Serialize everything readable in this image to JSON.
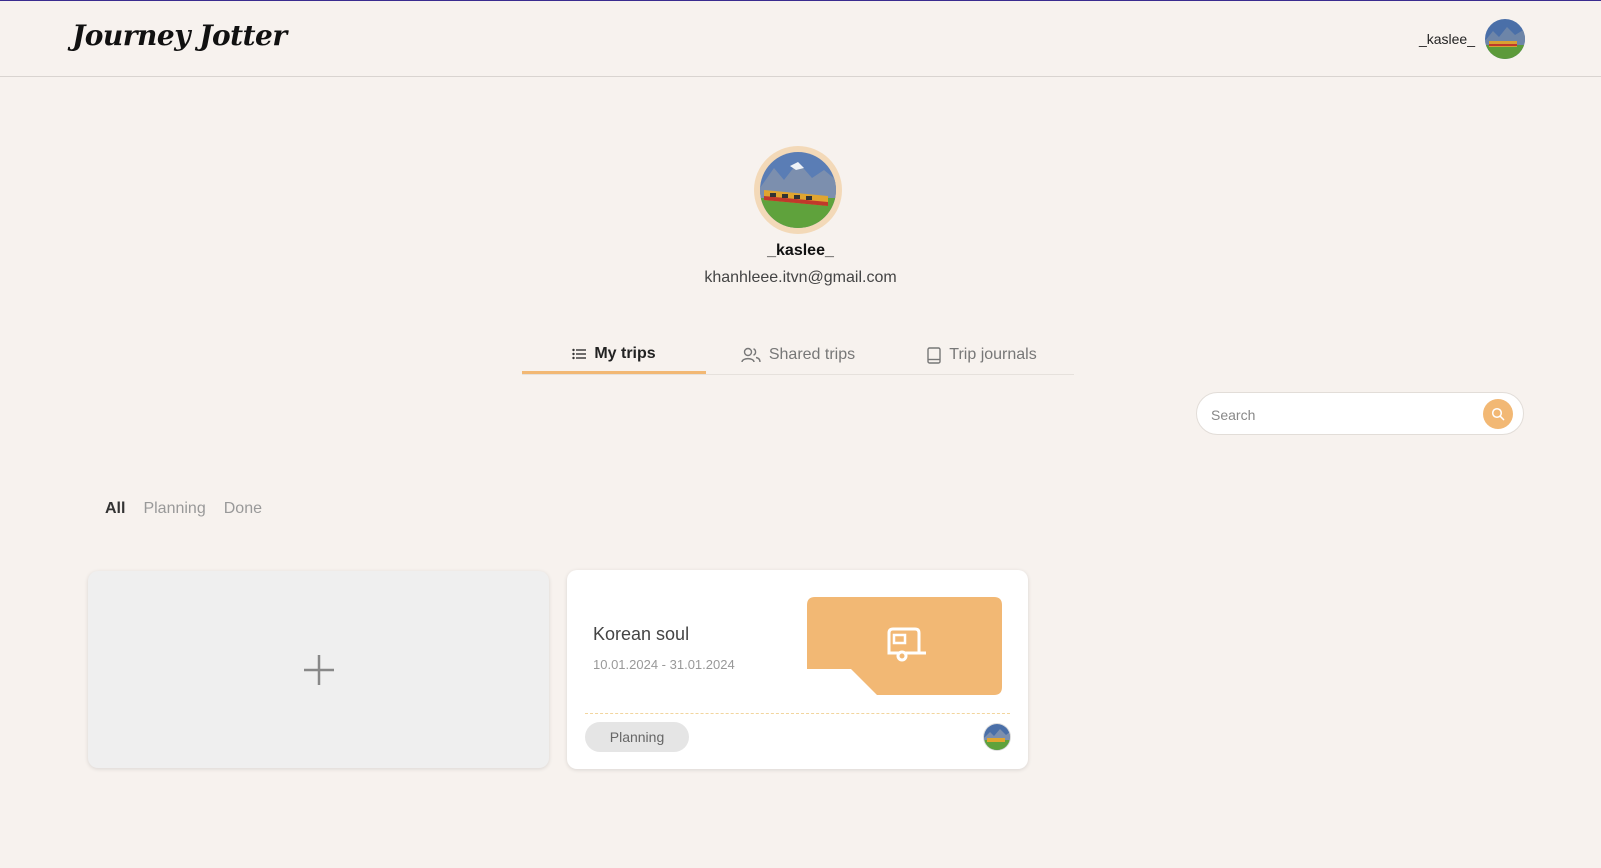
{
  "app": {
    "logo": "Journey Jotter"
  },
  "header": {
    "username": "_kaslee_"
  },
  "profile": {
    "username": "_kaslee_",
    "email": "khanhleee.itvn@gmail.com"
  },
  "tabs": [
    {
      "label": "My trips",
      "icon": "list-icon",
      "active": true
    },
    {
      "label": "Shared trips",
      "icon": "users-icon",
      "active": false
    },
    {
      "label": "Trip journals",
      "icon": "book-icon",
      "active": false
    }
  ],
  "search": {
    "placeholder": "Search",
    "value": ""
  },
  "filters": [
    {
      "label": "All",
      "active": true
    },
    {
      "label": "Planning",
      "active": false
    },
    {
      "label": "Done",
      "active": false
    }
  ],
  "trips": [
    {
      "title": "Korean soul",
      "dates": "10.01.2024 - 31.01.2024",
      "status": "Planning",
      "cover_icon": "caravan-icon"
    }
  ],
  "colors": {
    "background": "#f7f2ee",
    "accent": "#f2b874",
    "card": "#ffffff",
    "add_card": "#efefef"
  }
}
